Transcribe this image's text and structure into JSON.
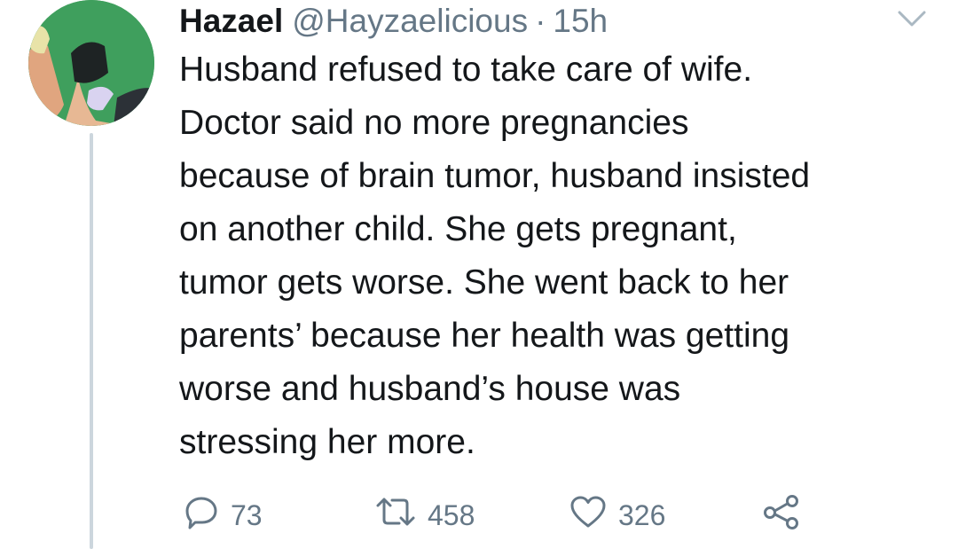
{
  "tweet": {
    "display_name": "Hazael",
    "handle": "@Hayzaelicious",
    "separator": "·",
    "time": "15h",
    "text_lines": [
      "Husband refused to take care of wife.",
      "Doctor said no more pregnancies",
      "because of brain tumor, husband insisted",
      "on another child. She gets pregnant,",
      "tumor gets worse. She went back to her",
      "parents’ because her health was getting",
      "worse and husband’s house was",
      "stressing her more."
    ]
  },
  "actions": {
    "reply_count": "73",
    "retweet_count": "458",
    "like_count": "326"
  },
  "icons": {
    "reply": "reply-icon",
    "retweet": "retweet-icon",
    "like": "heart-icon",
    "share": "share-icon",
    "menu": "chevron-down-icon"
  },
  "colors": {
    "text": "#14171a",
    "secondary": "#657786",
    "thread_line": "#ccd6dd",
    "avatar_bg": "#3a9a58"
  }
}
